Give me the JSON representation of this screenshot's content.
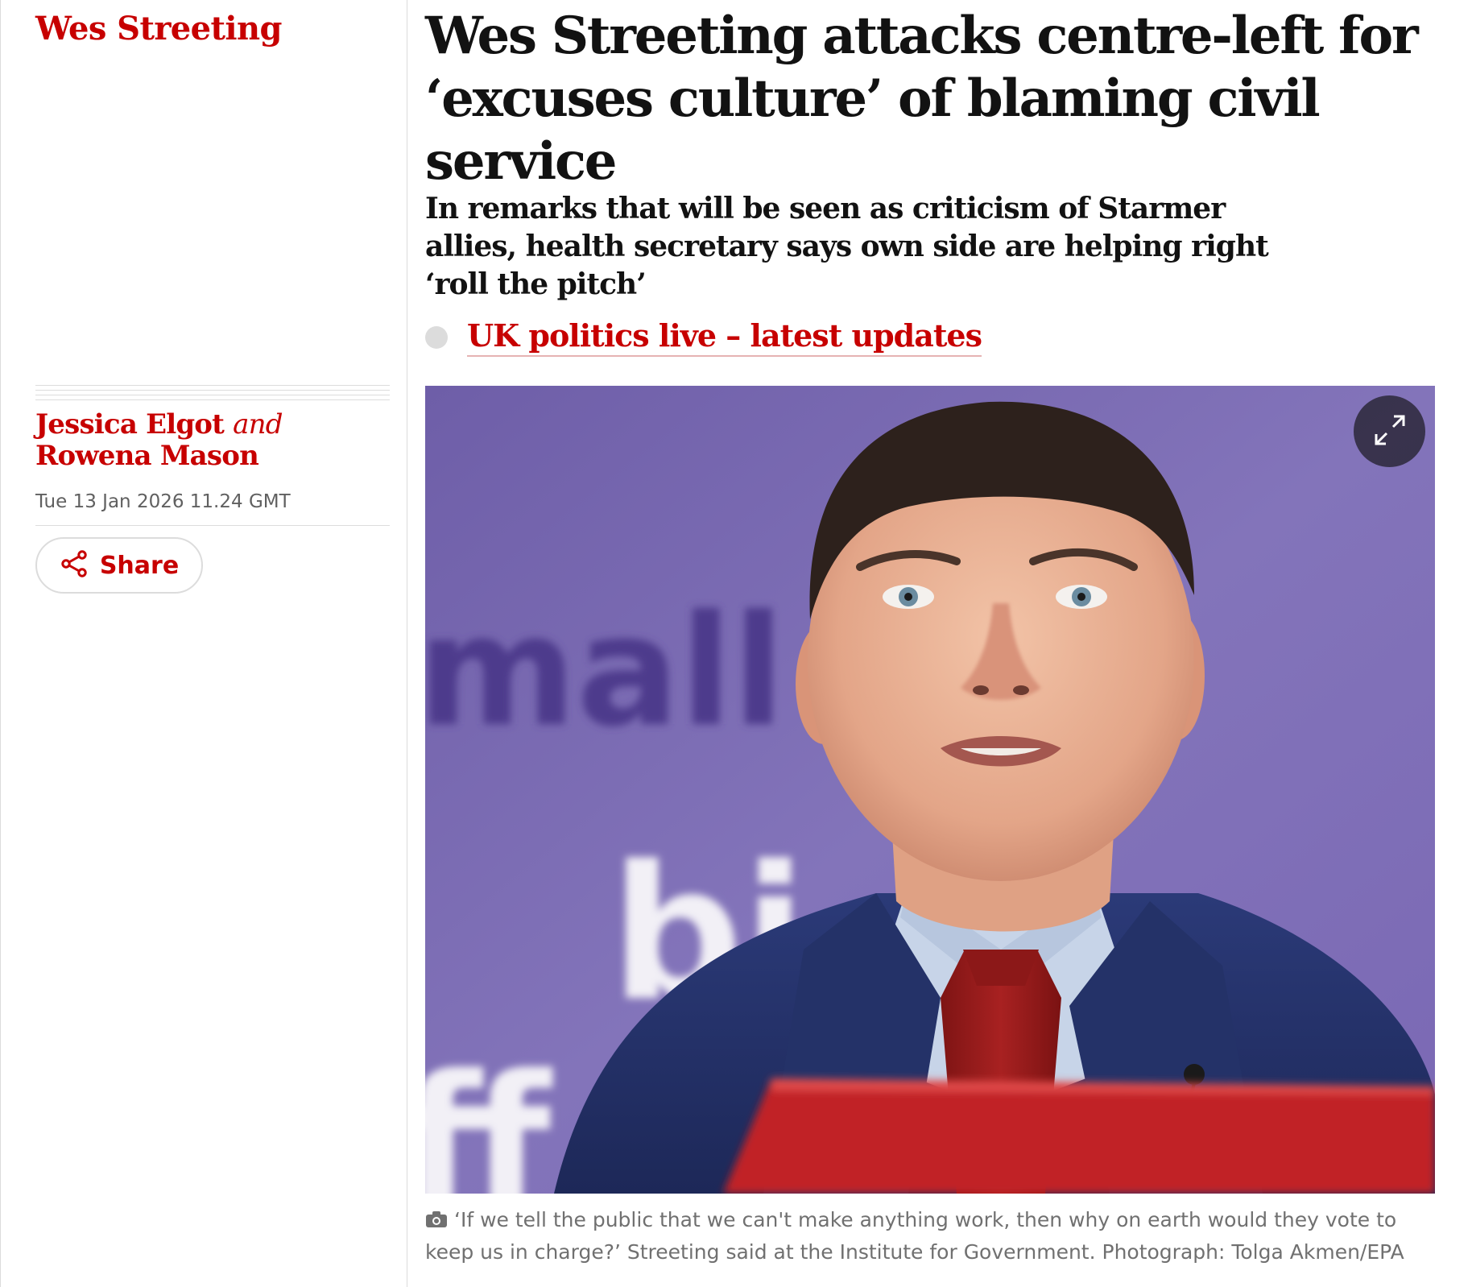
{
  "section": {
    "kicker": "Wes Streeting"
  },
  "article": {
    "headline": "Wes Streeting attacks centre-left for ‘excuses culture’ of blaming civil service",
    "standfirst": "In remarks that will be seen as criticism of Starmer allies, health secretary says own side are helping right ‘roll the pitch’",
    "live_link": "UK politics live – latest updates"
  },
  "byline": {
    "author1": "Jessica Elgot",
    "conjunction": "and",
    "author2": "Rowena Mason",
    "date": "Tue 13 Jan 2026 11.24 GMT"
  },
  "share": {
    "label": "Share",
    "icon": "share-icon"
  },
  "photo": {
    "expand_icon": "expand-icon",
    "background_letters": "mall d s,",
    "background_word2": "bi",
    "background_word3": "ff",
    "caption": "‘If we tell the public that we can't make anything work, then why on earth would they vote to keep us in charge?’ Streeting said at the Institute for Government. Photograph: Tolga Akmen/EPA",
    "caption_icon": "camera-icon"
  },
  "colors": {
    "brand_red": "#c70000",
    "text": "#121212",
    "muted": "#707070",
    "rule": "#dcdcdc",
    "photo_bg": "#7b6ab0"
  }
}
